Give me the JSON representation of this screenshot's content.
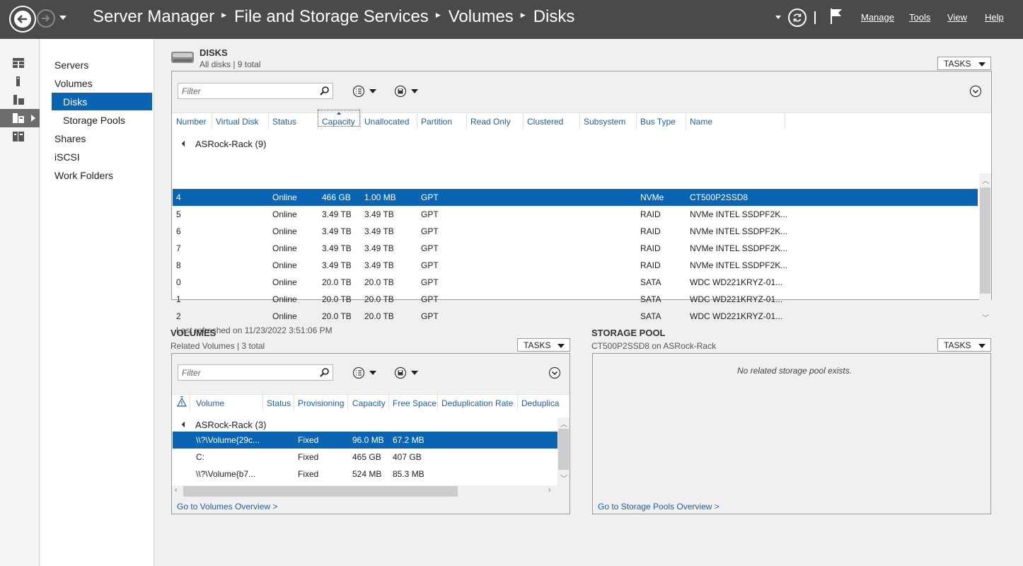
{
  "titlebar": {
    "breadcrumb": [
      "Server Manager",
      "File and Storage Services",
      "Volumes",
      "Disks"
    ],
    "menu": [
      "Manage",
      "Tools",
      "View",
      "Help"
    ]
  },
  "nav": {
    "items": [
      "Servers",
      "Volumes",
      "Disks",
      "Storage Pools",
      "Shares",
      "iSCSI",
      "Work Folders"
    ],
    "selected": "Disks"
  },
  "disks": {
    "title": "DISKS",
    "subtitle": "All disks | 9 total",
    "tasks": "TASKS",
    "filter_placeholder": "Filter",
    "columns": [
      "Number",
      "Virtual Disk",
      "Status",
      "Capacity",
      "Unallocated",
      "Partition",
      "Read Only",
      "Clustered",
      "Subsystem",
      "Bus Type",
      "Name"
    ],
    "group": "ASRock-Rack (9)",
    "rows": [
      {
        "number": "4",
        "status": "Online",
        "capacity": "466 GB",
        "unallocated": "1.00 MB",
        "partition": "GPT",
        "bus": "NVMe",
        "name": "CT500P2SSD8"
      },
      {
        "number": "5",
        "status": "Online",
        "capacity": "3.49 TB",
        "unallocated": "3.49 TB",
        "partition": "GPT",
        "bus": "RAID",
        "name": "NVMe INTEL SSDPF2K..."
      },
      {
        "number": "6",
        "status": "Online",
        "capacity": "3.49 TB",
        "unallocated": "3.49 TB",
        "partition": "GPT",
        "bus": "RAID",
        "name": "NVMe INTEL SSDPF2K..."
      },
      {
        "number": "7",
        "status": "Online",
        "capacity": "3.49 TB",
        "unallocated": "3.49 TB",
        "partition": "GPT",
        "bus": "RAID",
        "name": "NVMe INTEL SSDPF2K..."
      },
      {
        "number": "8",
        "status": "Online",
        "capacity": "3.49 TB",
        "unallocated": "3.49 TB",
        "partition": "GPT",
        "bus": "RAID",
        "name": "NVMe INTEL SSDPF2K..."
      },
      {
        "number": "0",
        "status": "Online",
        "capacity": "20.0 TB",
        "unallocated": "20.0 TB",
        "partition": "GPT",
        "bus": "SATA",
        "name": "WDC WD221KRYZ-01..."
      },
      {
        "number": "1",
        "status": "Online",
        "capacity": "20.0 TB",
        "unallocated": "20.0 TB",
        "partition": "GPT",
        "bus": "SATA",
        "name": "WDC WD221KRYZ-01..."
      },
      {
        "number": "2",
        "status": "Online",
        "capacity": "20.0 TB",
        "unallocated": "20.0 TB",
        "partition": "GPT",
        "bus": "SATA",
        "name": "WDC WD221KRYZ-01..."
      }
    ],
    "last_refreshed": "Last refreshed on 11/23/2022 3:51:06 PM"
  },
  "volumes": {
    "title": "VOLUMES",
    "subtitle": "Related Volumes | 3 total",
    "tasks": "TASKS",
    "filter_placeholder": "Filter",
    "columns": [
      "Volume",
      "Status",
      "Provisioning",
      "Capacity",
      "Free Space",
      "Deduplication Rate",
      "Deduplica"
    ],
    "group": "ASRock-Rack (3)",
    "rows": [
      {
        "volume": "\\\\?\\Volume{29c...",
        "provisioning": "Fixed",
        "capacity": "96.0 MB",
        "free": "67.2 MB"
      },
      {
        "volume": "C:",
        "provisioning": "Fixed",
        "capacity": "465 GB",
        "free": "407 GB"
      },
      {
        "volume": "\\\\?\\Volume{b7...",
        "provisioning": "Fixed",
        "capacity": "524 MB",
        "free": "85.3 MB"
      }
    ],
    "overview_link": "Go to Volumes Overview >"
  },
  "storage_pool": {
    "title": "STORAGE POOL",
    "subtitle": "CT500P2SSD8 on ASRock-Rack",
    "tasks": "TASKS",
    "empty_message": "No related storage pool exists.",
    "overview_link": "Go to Storage Pools Overview >"
  },
  "colors": {
    "titlebar": "#4a4a4a",
    "selection": "#0a64b4",
    "link": "#1e5fa8"
  }
}
